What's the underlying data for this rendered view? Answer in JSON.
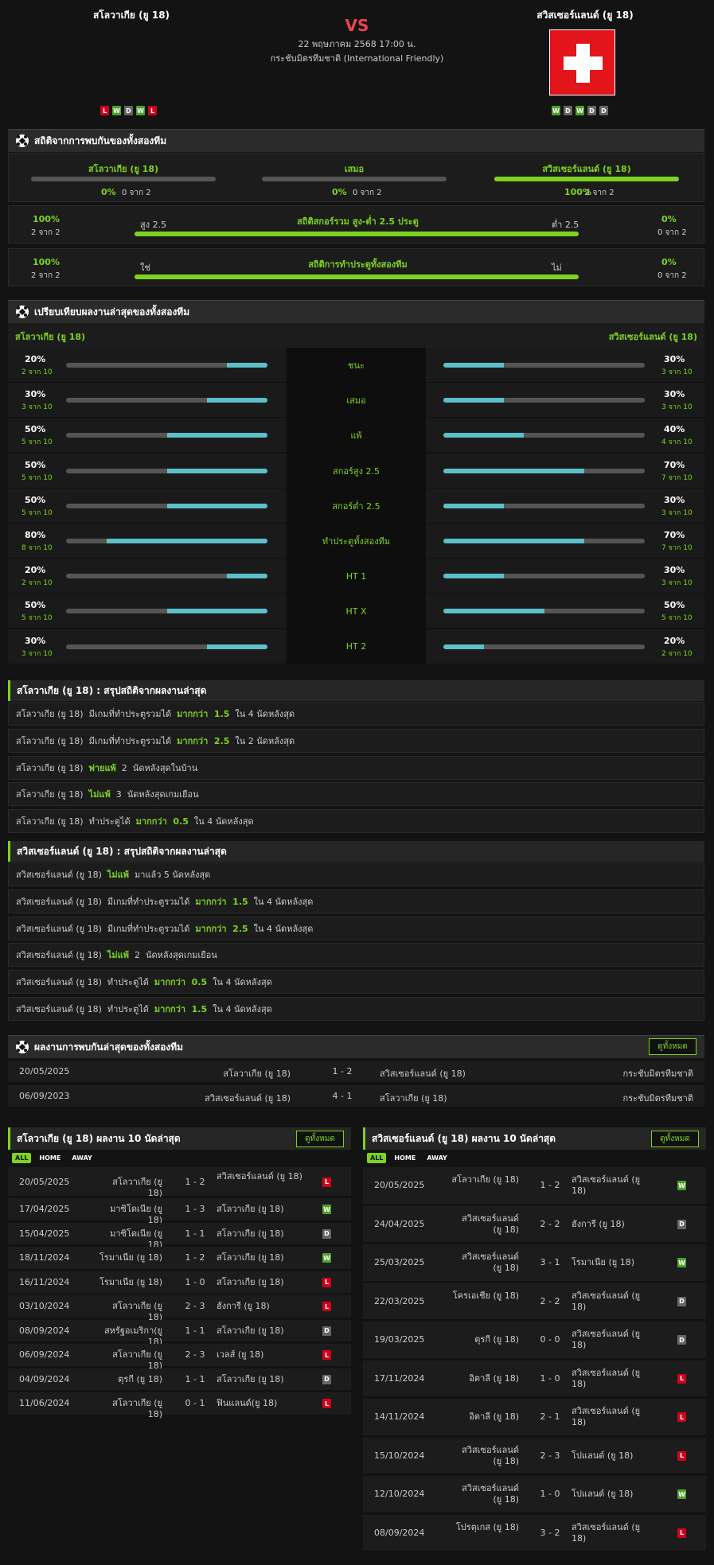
{
  "match": {
    "home": "สโลวาเกีย (ยู 18)",
    "away": "สวิสเซอร์แลนด์ (ยู 18)",
    "vs": "VS",
    "date": "22 พฤษภาคม 2568 17:00 น.",
    "competition": "กระชับมิตรทีมชาติ (International Friendly)",
    "home_form": [
      "L",
      "W",
      "D",
      "W",
      "L"
    ],
    "away_form": [
      "W",
      "D",
      "W",
      "D",
      "D"
    ],
    "colors": {
      "accent": "#7ed321",
      "vs": "#e8454f",
      "flag_red": "#e3141a"
    }
  },
  "h2h_stats": {
    "title": "สถิติจากการพบกันของทั้งสองทีม",
    "cols": [
      {
        "label": "สโลวาเกีย (ยู 18)",
        "pct": "0%",
        "count": "0 จาก 2",
        "value": 0
      },
      {
        "label": "เสมอ",
        "pct": "0%",
        "count": "0 จาก 2",
        "value": 0
      },
      {
        "label": "สวิสเซอร์แลนด์ (ยู 18)",
        "pct": "100%",
        "count": "2 จาก 2",
        "value": 1
      }
    ],
    "rows": [
      {
        "left_pct": "100%",
        "left_count": "2 จาก 2",
        "left_tag": "สูง 2.5",
        "title": "สถิติสกอร์รวม สูง-ต่ำ 2.5 ประตู",
        "right_tag": "ต่ำ 2.5",
        "right_pct": "0%",
        "right_count": "0 จาก 2",
        "value": 1
      },
      {
        "left_pct": "100%",
        "left_count": "2 จาก 2",
        "left_tag": "ใช่",
        "title": "สถิติการทำประตูทั้งสองทีม",
        "right_tag": "ไม่",
        "right_pct": "0%",
        "right_count": "0 จาก 2",
        "value": 1
      }
    ]
  },
  "compare": {
    "title": "เปรียบเทียบผลงานล่าสุดของทั้งสองทีม",
    "home": "สโลวาเกีย (ยู 18)",
    "away": "สวิสเซอร์แลนด์ (ยู 18)",
    "rows": [
      {
        "label": "ชนะ",
        "lp": "20%",
        "lc": "2 จาก 10",
        "lv": 0.2,
        "rp": "30%",
        "rc": "3 จาก 10",
        "rv": 0.3
      },
      {
        "label": "เสมอ",
        "lp": "30%",
        "lc": "3 จาก 10",
        "lv": 0.3,
        "rp": "30%",
        "rc": "3 จาก 10",
        "rv": 0.3
      },
      {
        "label": "แพ้",
        "lp": "50%",
        "lc": "5 จาก 10",
        "lv": 0.5,
        "rp": "40%",
        "rc": "4 จาก 10",
        "rv": 0.4
      },
      {
        "label": "สกอร์สูง 2.5",
        "lp": "50%",
        "lc": "5 จาก 10",
        "lv": 0.5,
        "rp": "70%",
        "rc": "7 จาก 10",
        "rv": 0.7
      },
      {
        "label": "สกอร์ต่ำ 2.5",
        "lp": "50%",
        "lc": "5 จาก 10",
        "lv": 0.5,
        "rp": "30%",
        "rc": "3 จาก 10",
        "rv": 0.3
      },
      {
        "label": "ทำประตูทั้งสองทีม",
        "lp": "80%",
        "lc": "8 จาก 10",
        "lv": 0.8,
        "rp": "70%",
        "rc": "7 จาก 10",
        "rv": 0.7
      },
      {
        "label": "HT 1",
        "lp": "20%",
        "lc": "2 จาก 10",
        "lv": 0.2,
        "rp": "30%",
        "rc": "3 จาก 10",
        "rv": 0.3
      },
      {
        "label": "HT X",
        "lp": "50%",
        "lc": "5 จาก 10",
        "lv": 0.5,
        "rp": "50%",
        "rc": "5 จาก 10",
        "rv": 0.5
      },
      {
        "label": "HT 2",
        "lp": "30%",
        "lc": "3 จาก 10",
        "lv": 0.3,
        "rp": "20%",
        "rc": "2 จาก 10",
        "rv": 0.2
      }
    ]
  },
  "home_summary": {
    "title": "สโลวาเกีย (ยู 18) : สรุปสถิติจากผลงานล่าสุด",
    "rows": [
      [
        "สโลวาเกีย (ยู 18)  มีเกมที่ทำประตูรวมได้  ",
        "มากกว่า  1.5",
        "  ใน 4 นัดหลังสุด"
      ],
      [
        "สโลวาเกีย (ยู 18)  มีเกมที่ทำประตูรวมได้  ",
        "มากกว่า  2.5",
        "  ใน 2 นัดหลังสุด"
      ],
      [
        "สโลวาเกีย (ยู 18)  ",
        "พ่ายแพ้",
        "  2  นัดหลังสุดในบ้าน"
      ],
      [
        "สโลวาเกีย (ยู 18)  ",
        "ไม่แพ้",
        "  3  นัดหลังสุดเกมเยือน"
      ],
      [
        "สโลวาเกีย (ยู 18)  ทำประตูได้  ",
        "มากกว่า  0.5",
        "  ใน 4 นัดหลังสุด"
      ]
    ]
  },
  "away_summary": {
    "title": "สวิสเซอร์แลนด์ (ยู 18) : สรุปสถิติจากผลงานล่าสุด",
    "rows": [
      [
        "สวิสเซอร์แลนด์ (ยู 18)  ",
        "ไม่แพ้",
        "  มาแล้ว 5 นัดหลังสุด"
      ],
      [
        "สวิสเซอร์แลนด์ (ยู 18)  มีเกมที่ทำประตูรวมได้  ",
        "มากกว่า  1.5",
        "  ใน 4 นัดหลังสุด"
      ],
      [
        "สวิสเซอร์แลนด์ (ยู 18)  มีเกมที่ทำประตูรวมได้  ",
        "มากกว่า  2.5",
        "  ใน 4 นัดหลังสุด"
      ],
      [
        "สวิสเซอร์แลนด์ (ยู 18)  ",
        "ไม่แพ้",
        "  2  นัดหลังสุดเกมเยือน"
      ],
      [
        "สวิสเซอร์แลนด์ (ยู 18)  ทำประตูได้  ",
        "มากกว่า  0.5",
        "  ใน 4 นัดหลังสุด"
      ],
      [
        "สวิสเซอร์แลนด์ (ยู 18)  ทำประตูได้  ",
        "มากกว่า  1.5",
        "  ใน 4 นัดหลังสุด"
      ]
    ]
  },
  "h2h_results": {
    "title": "ผลงานการพบกันล่าสุดของทั้งสองทีม",
    "view_all": "ดูทั้งหมด",
    "rows": [
      {
        "date": "20/05/2025",
        "home": "สโลวาเกีย (ยู 18)",
        "score": "1 - 2",
        "away": "สวิสเซอร์แลนด์ (ยู 18)",
        "comp": "กระชับมิตรทีมชาติ"
      },
      {
        "date": "06/09/2023",
        "home": "สวิสเซอร์แลนด์ (ยู 18)",
        "score": "4 - 1",
        "away": "สโลวาเกีย (ยู 18)",
        "comp": "กระชับมิตรทีมชาติ"
      }
    ]
  },
  "home_last10": {
    "title": "สโลวาเกีย (ยู 18) ผลงาน 10 นัดล่าสุด",
    "view_all": "ดูทั้งหมด",
    "tabs": [
      "ALL",
      "HOME",
      "AWAY"
    ],
    "rows": [
      {
        "date": "20/05/2025",
        "home": "สโลวาเกีย (ยู 18)",
        "score": "1 - 2",
        "away": "สวิสเซอร์แลนด์ (ยู 18)",
        "r": "L"
      },
      {
        "date": "17/04/2025",
        "home": "มาซิโดเนีย (ยู 18)",
        "score": "1 - 3",
        "away": "สโลวาเกีย (ยู 18)",
        "r": "W"
      },
      {
        "date": "15/04/2025",
        "home": "มาซิโดเนีย (ยู 18)",
        "score": "1 - 1",
        "away": "สโลวาเกีย (ยู 18)",
        "r": "D"
      },
      {
        "date": "18/11/2024",
        "home": "โรมาเนีย (ยู 18)",
        "score": "1 - 2",
        "away": "สโลวาเกีย (ยู 18)",
        "r": "W"
      },
      {
        "date": "16/11/2024",
        "home": "โรมาเนีย (ยู 18)",
        "score": "1 - 0",
        "away": "สโลวาเกีย (ยู 18)",
        "r": "L"
      },
      {
        "date": "03/10/2024",
        "home": "สโลวาเกีย (ยู 18)",
        "score": "2 - 3",
        "away": "ฮังการี (ยู 18)",
        "r": "L"
      },
      {
        "date": "08/09/2024",
        "home": "สหรัฐอเมริกา(ยู 18)",
        "score": "1 - 1",
        "away": "สโลวาเกีย (ยู 18)",
        "r": "D"
      },
      {
        "date": "06/09/2024",
        "home": "สโลวาเกีย (ยู 18)",
        "score": "2 - 3",
        "away": "เวลส์ (ยู 18)",
        "r": "L"
      },
      {
        "date": "04/09/2024",
        "home": "ตุรกี (ยู 18)",
        "score": "1 - 1",
        "away": "สโลวาเกีย (ยู 18)",
        "r": "D"
      },
      {
        "date": "11/06/2024",
        "home": "สโลวาเกีย (ยู 18)",
        "score": "0 - 1",
        "away": "ฟินแลนด์(ยู 18)",
        "r": "L"
      }
    ]
  },
  "away_last10": {
    "title": "สวิสเซอร์แลนด์ (ยู 18) ผลงาน 10 นัดล่าสุด",
    "view_all": "ดูทั้งหมด",
    "tabs": [
      "ALL",
      "HOME",
      "AWAY"
    ],
    "rows": [
      {
        "date": "20/05/2025",
        "home": "สโลวาเกีย (ยู 18)",
        "score": "1 - 2",
        "away": "สวิสเซอร์แลนด์ (ยู 18)",
        "r": "W"
      },
      {
        "date": "24/04/2025",
        "home": "สวิสเซอร์แลนด์ (ยู 18)",
        "score": "2 - 2",
        "away": "ฮังการี (ยู 18)",
        "r": "D"
      },
      {
        "date": "25/03/2025",
        "home": "สวิสเซอร์แลนด์ (ยู 18)",
        "score": "3 - 1",
        "away": "โรมาเนีย (ยู 18)",
        "r": "W"
      },
      {
        "date": "22/03/2025",
        "home": "โครเอเชีย (ยู 18)",
        "score": "2 - 2",
        "away": "สวิสเซอร์แลนด์ (ยู 18)",
        "r": "D"
      },
      {
        "date": "19/03/2025",
        "home": "ตุรกี (ยู 18)",
        "score": "0 - 0",
        "away": "สวิสเซอร์แลนด์ (ยู 18)",
        "r": "D"
      },
      {
        "date": "17/11/2024",
        "home": "อิตาลี (ยู 18)",
        "score": "1 - 0",
        "away": "สวิสเซอร์แลนด์ (ยู 18)",
        "r": "L"
      },
      {
        "date": "14/11/2024",
        "home": "อิตาลี (ยู 18)",
        "score": "2 - 1",
        "away": "สวิสเซอร์แลนด์ (ยู 18)",
        "r": "L"
      },
      {
        "date": "15/10/2024",
        "home": "สวิสเซอร์แลนด์ (ยู 18)",
        "score": "2 - 3",
        "away": "โปแลนด์ (ยู 18)",
        "r": "L"
      },
      {
        "date": "12/10/2024",
        "home": "สวิสเซอร์แลนด์ (ยู 18)",
        "score": "1 - 0",
        "away": "โปแลนด์ (ยู 18)",
        "r": "W"
      },
      {
        "date": "08/09/2024",
        "home": "โปรตุเกส (ยู 18)",
        "score": "3 - 2",
        "away": "สวิสเซอร์แลนด์ (ยู 18)",
        "r": "L"
      }
    ]
  }
}
